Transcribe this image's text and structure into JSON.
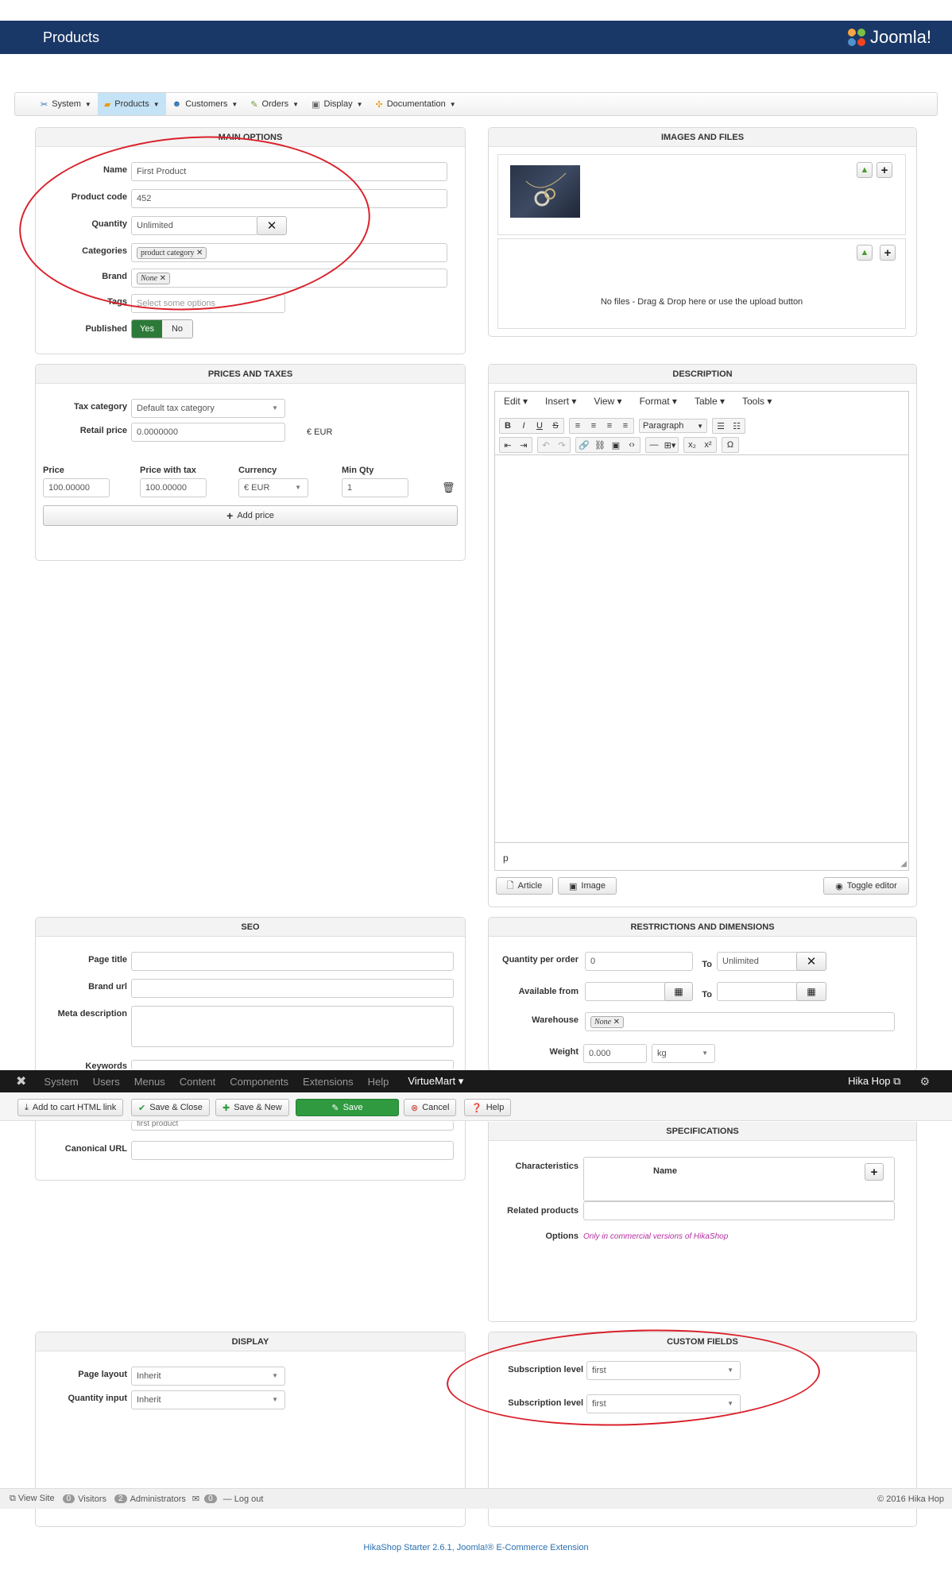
{
  "header": {
    "title": "Products",
    "logo_text": "Joomla!"
  },
  "menu": [
    {
      "label": "System",
      "icon": "tools-icon"
    },
    {
      "label": "Products",
      "icon": "products-icon",
      "active": true
    },
    {
      "label": "Customers",
      "icon": "customers-icon"
    },
    {
      "label": "Orders",
      "icon": "orders-icon"
    },
    {
      "label": "Display",
      "icon": "display-icon"
    },
    {
      "label": "Documentation",
      "icon": "documentation-icon"
    }
  ],
  "main_options": {
    "title": "MAIN OPTIONS",
    "name_label": "Name",
    "name_value": "First Product",
    "code_label": "Product code",
    "code_value": "452",
    "qty_label": "Quantity",
    "qty_value": "Unlimited",
    "cat_label": "Categories",
    "cat_tag": "product category",
    "brand_label": "Brand",
    "brand_tag": "None",
    "tags_label": "Tags",
    "tags_placeholder": "Select some options",
    "pub_label": "Published",
    "pub_yes": "Yes",
    "pub_no": "No"
  },
  "images": {
    "title": "IMAGES AND FILES",
    "nofiles": "No files - Drag & Drop here or use the upload button"
  },
  "prices": {
    "title": "PRICES AND TAXES",
    "tax_label": "Tax category",
    "tax_value": "Default tax category",
    "retail_label": "Retail price",
    "retail_value": "0.0000000",
    "retail_currency": "€ EUR",
    "cols": [
      "Price",
      "Price with tax",
      "Currency",
      "Min Qty"
    ],
    "row": [
      "100.00000",
      "100.00000",
      "€ EUR",
      "1"
    ],
    "add_price": "Add price"
  },
  "description": {
    "title": "DESCRIPTION",
    "menus": [
      "Edit",
      "Insert",
      "View",
      "Format",
      "Table",
      "Tools"
    ],
    "paragraph": "Paragraph",
    "path": "p",
    "article_btn": "Article",
    "image_btn": "Image",
    "toggle_btn": "Toggle editor"
  },
  "seo": {
    "title": "SEO",
    "page_title_label": "Page title",
    "brand_url_label": "Brand url",
    "meta_label": "Meta description",
    "keywords_label": "Keywords",
    "keywords_value": "first product",
    "canonical_label": "Canonical URL"
  },
  "restrictions": {
    "title": "RESTRICTIONS AND DIMENSIONS",
    "qpo_label": "Quantity per order",
    "qpo_from": "0",
    "to": "To",
    "qpo_to": "Unlimited",
    "avail_label": "Available from",
    "warehouse_label": "Warehouse",
    "warehouse_tag": "None",
    "weight_label": "Weight",
    "weight_value": "0.000",
    "weight_unit": "kg"
  },
  "adminbar": {
    "items": [
      "System",
      "Users",
      "Menus",
      "Content",
      "Components",
      "Extensions",
      "Help"
    ],
    "active": "VirtueMart",
    "right": "Hika Hop"
  },
  "toolbar": {
    "add_cart": "Add to cart HTML link",
    "save_close": "Save & Close",
    "save_new": "Save & New",
    "save": "Save",
    "cancel": "Cancel",
    "help": "Help"
  },
  "specifications": {
    "title": "SPECIFICATIONS",
    "char_label": "Characteristics",
    "name_col": "Name",
    "related_label": "Related products",
    "options_label": "Options",
    "options_note": "Only in commercial versions of HikaShop"
  },
  "display": {
    "title": "DISPLAY",
    "layout_label": "Page layout",
    "layout_value": "Inherit",
    "qty_label": "Quantity input",
    "qty_value": "Inherit"
  },
  "custom": {
    "title": "CUSTOM FIELDS",
    "f1_label": "Subscription level",
    "f1_value": "first",
    "f2_label": "Subscription level",
    "f2_value": "first"
  },
  "status": {
    "view_site": "View Site",
    "visitors_count": "0",
    "visitors": "Visitors",
    "admins_count": "2",
    "admins": "Administrators",
    "msg_count": "0",
    "logout": "Log out",
    "copyright": "© 2016 Hika Hop"
  },
  "footer": "HikaShop Starter 2.6.1, Joomla!® E-Commerce Extension",
  "colors": {
    "header": "#1a3867",
    "accent_red": "#d9202a",
    "published_green": "#2c7a38",
    "save_green": "#2f9a3f"
  }
}
